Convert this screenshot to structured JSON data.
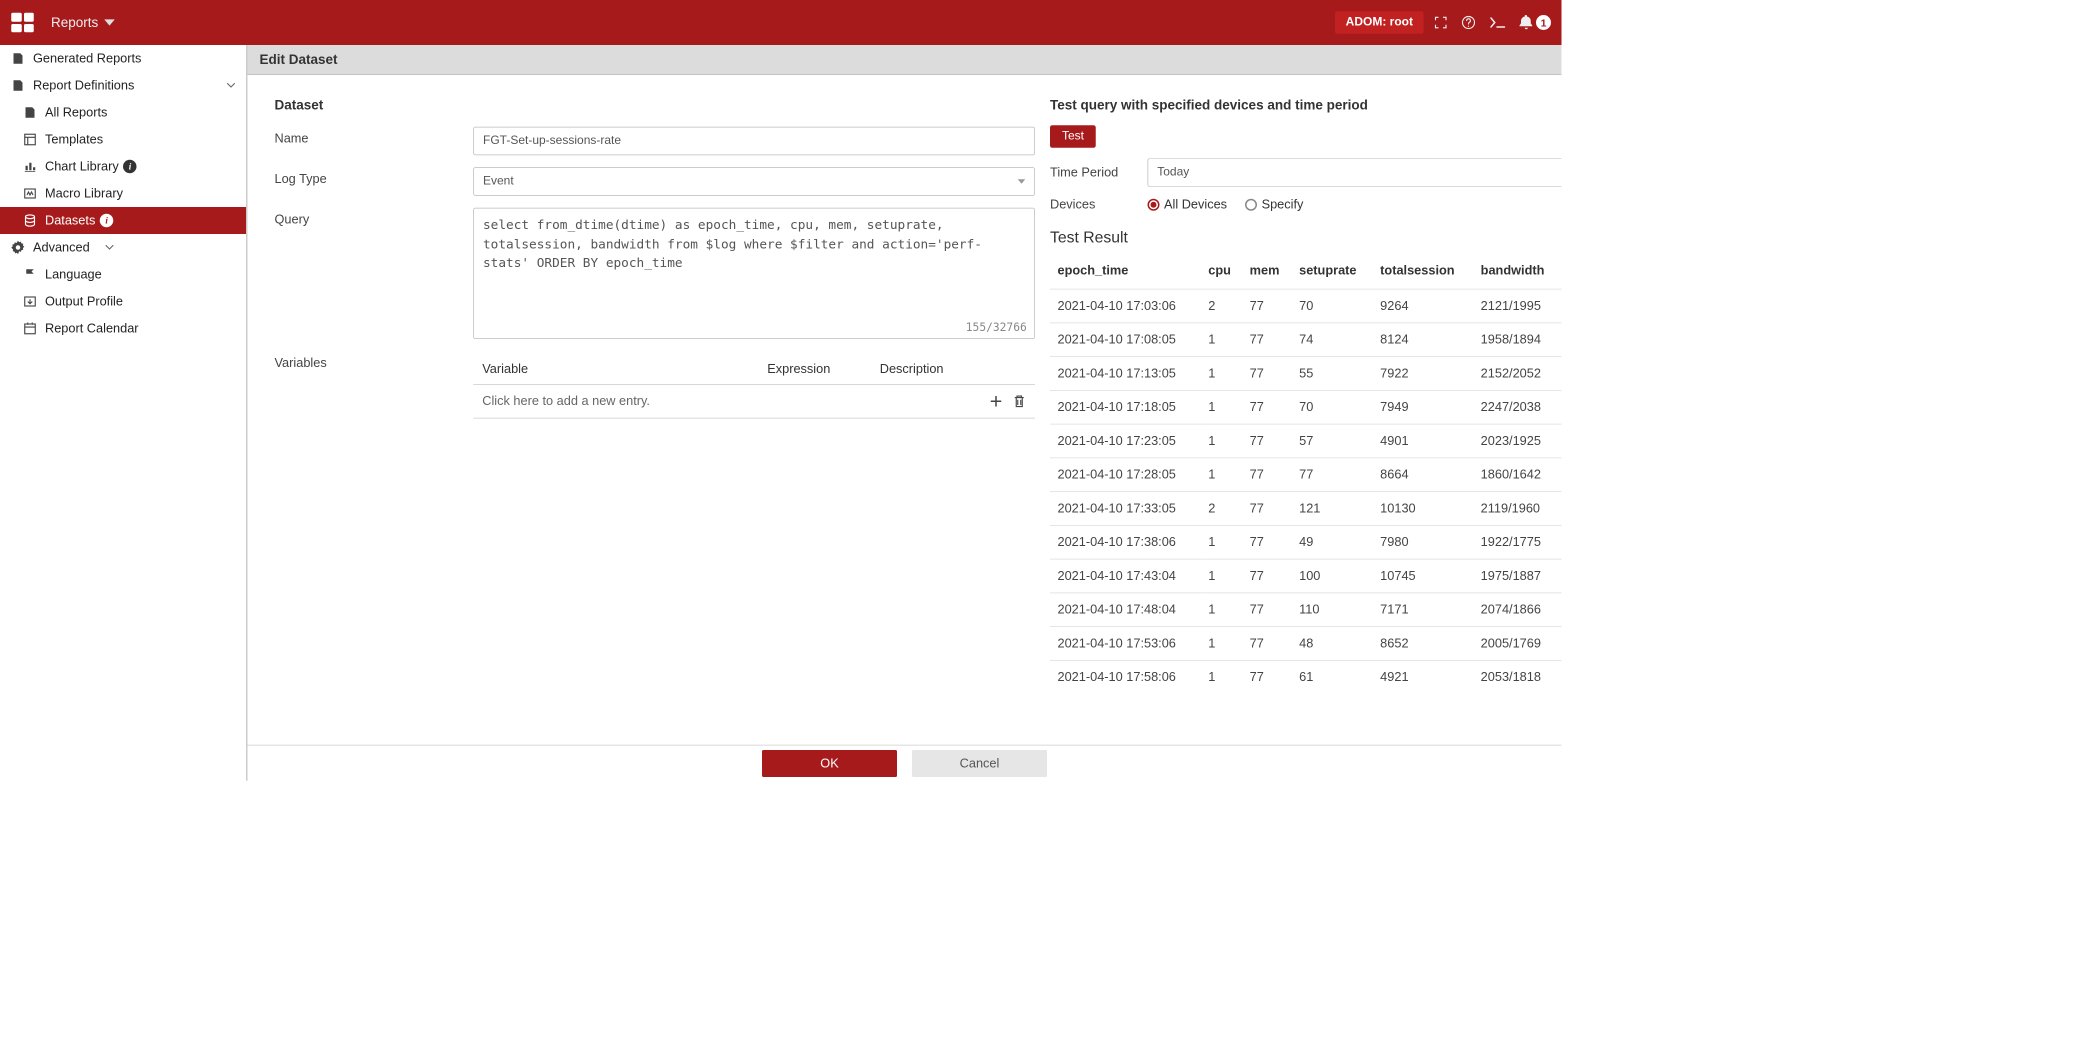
{
  "header": {
    "menu_label": "Reports",
    "adom_label": "ADOM: root",
    "notification_count": "1"
  },
  "sidebar": {
    "items": [
      {
        "label": "Generated Reports"
      },
      {
        "label": "Report Definitions"
      },
      {
        "label": "All Reports"
      },
      {
        "label": "Templates"
      },
      {
        "label": "Chart Library"
      },
      {
        "label": "Macro Library"
      },
      {
        "label": "Datasets"
      },
      {
        "label": "Advanced"
      },
      {
        "label": "Language"
      },
      {
        "label": "Output Profile"
      },
      {
        "label": "Report Calendar"
      }
    ]
  },
  "page": {
    "title": "Edit Dataset",
    "section_title": "Dataset",
    "form": {
      "name_label": "Name",
      "name_value": "FGT-Set-up-sessions-rate",
      "logtype_label": "Log Type",
      "logtype_value": "Event",
      "query_label": "Query",
      "query_value": "select from_dtime(dtime) as epoch_time, cpu, mem, setuprate, totalsession, bandwidth from $log where $filter and   action='perf-stats' ORDER  BY epoch_time",
      "char_count": "155/32766",
      "variables_label": "Variables",
      "var_col_1": "Variable",
      "var_col_2": "Expression",
      "var_col_3": "Description",
      "var_placeholder": "Click here to add a new entry."
    }
  },
  "test": {
    "title": "Test query with specified devices and time period",
    "test_btn": "Test",
    "time_label": "Time Period",
    "time_value": "Today",
    "devices_label": "Devices",
    "radio_all": "All Devices",
    "radio_specify": "Specify",
    "result_title": "Test Result",
    "columns": [
      "epoch_time",
      "cpu",
      "mem",
      "setuprate",
      "totalsession",
      "bandwidth"
    ],
    "rows": [
      [
        "2021-04-10 17:03:06",
        "2",
        "77",
        "70",
        "9264",
        "2121/1995"
      ],
      [
        "2021-04-10 17:08:05",
        "1",
        "77",
        "74",
        "8124",
        "1958/1894"
      ],
      [
        "2021-04-10 17:13:05",
        "1",
        "77",
        "55",
        "7922",
        "2152/2052"
      ],
      [
        "2021-04-10 17:18:05",
        "1",
        "77",
        "70",
        "7949",
        "2247/2038"
      ],
      [
        "2021-04-10 17:23:05",
        "1",
        "77",
        "57",
        "4901",
        "2023/1925"
      ],
      [
        "2021-04-10 17:28:05",
        "1",
        "77",
        "77",
        "8664",
        "1860/1642"
      ],
      [
        "2021-04-10 17:33:05",
        "2",
        "77",
        "121",
        "10130",
        "2119/1960"
      ],
      [
        "2021-04-10 17:38:06",
        "1",
        "77",
        "49",
        "7980",
        "1922/1775"
      ],
      [
        "2021-04-10 17:43:04",
        "1",
        "77",
        "100",
        "10745",
        "1975/1887"
      ],
      [
        "2021-04-10 17:48:04",
        "1",
        "77",
        "110",
        "7171",
        "2074/1866"
      ],
      [
        "2021-04-10 17:53:06",
        "1",
        "77",
        "48",
        "8652",
        "2005/1769"
      ],
      [
        "2021-04-10 17:58:06",
        "1",
        "77",
        "61",
        "4921",
        "2053/1818"
      ]
    ]
  },
  "footer": {
    "ok": "OK",
    "cancel": "Cancel"
  }
}
